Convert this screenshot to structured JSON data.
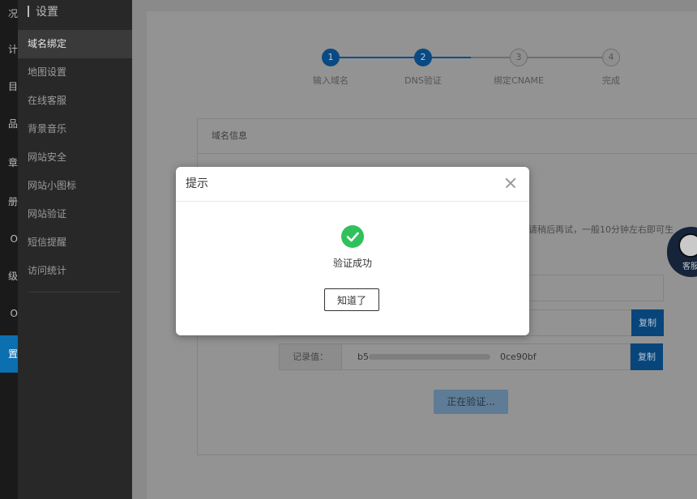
{
  "rail": {
    "items": [
      "况",
      "计",
      "目",
      "品",
      "章",
      "册",
      "O",
      "级",
      "O",
      "置"
    ]
  },
  "sidebar": {
    "title": "设置",
    "items": [
      {
        "label": "域名绑定"
      },
      {
        "label": "地图设置"
      },
      {
        "label": "在线客服"
      },
      {
        "label": "背景音乐"
      },
      {
        "label": "网站安全"
      },
      {
        "label": "网站小图标"
      },
      {
        "label": "网站验证"
      },
      {
        "label": "短信提醒"
      },
      {
        "label": "访问统计"
      }
    ]
  },
  "steps": [
    {
      "num": "1",
      "label": "输入域名",
      "state": "done"
    },
    {
      "num": "2",
      "label": "DNS验证",
      "state": "done"
    },
    {
      "num": "3",
      "label": "绑定CNAME",
      "state": "todo"
    },
    {
      "num": "4",
      "label": "完成",
      "state": "todo"
    }
  ],
  "panel": {
    "title": "域名信息",
    "note": "请稍后再试，一般10分钟左右即可生",
    "copy_label": "复制",
    "record_label": "记录值：",
    "record_value_start": "b5",
    "record_value_end": "0ce90bf",
    "verifying_label": "正在验证..."
  },
  "service": {
    "label": "客服"
  },
  "modal": {
    "title": "提示",
    "message": "验证成功",
    "confirm_label": "知道了"
  },
  "colors": {
    "accent": "#0c6fb0",
    "success": "#30c15c",
    "sidebar_bg": "#282828"
  }
}
